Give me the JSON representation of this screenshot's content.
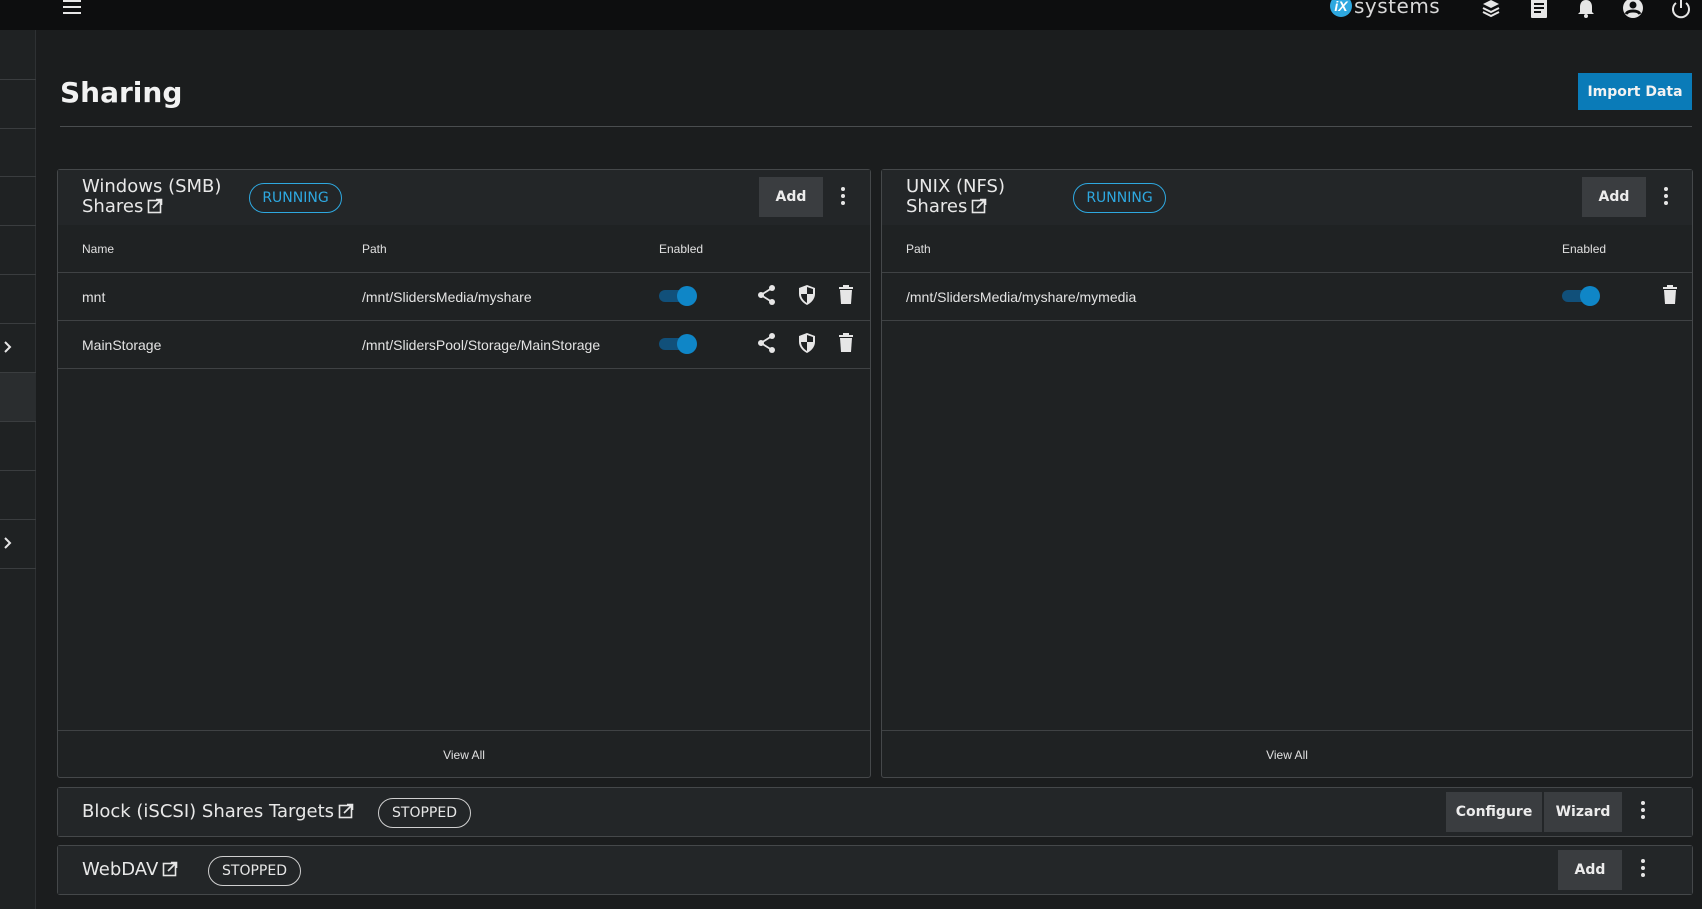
{
  "topbar": {
    "logo_letter": "iX",
    "logo_text": "systems",
    "icons": [
      "menu-icon",
      "truecommand-icon",
      "tasks-icon",
      "bell-icon",
      "account-icon",
      "power-icon"
    ]
  },
  "header": {
    "title": "Sharing",
    "import_label": "Import Data"
  },
  "smb": {
    "title_line1": "Windows (SMB)",
    "title_line2": "Shares",
    "status": "RUNNING",
    "add_label": "Add",
    "columns": [
      "Name",
      "Path",
      "Enabled"
    ],
    "rows": [
      {
        "name": "mnt",
        "path": "/mnt/SlidersMedia/myshare",
        "enabled": true
      },
      {
        "name": "MainStorage",
        "path": "/mnt/SlidersPool/Storage/MainStorage",
        "enabled": true
      }
    ],
    "view_all": "View All"
  },
  "nfs": {
    "title_line1": "UNIX (NFS)",
    "title_line2": "Shares",
    "status": "RUNNING",
    "add_label": "Add",
    "columns": [
      "Path",
      "Enabled"
    ],
    "rows": [
      {
        "path": "/mnt/SlidersMedia/myshare/mymedia",
        "enabled": true
      }
    ],
    "view_all": "View All"
  },
  "iscsi": {
    "title": "Block (iSCSI) Shares Targets",
    "status": "STOPPED",
    "configure_label": "Configure",
    "wizard_label": "Wizard"
  },
  "webdav": {
    "title": "WebDAV",
    "status": "STOPPED",
    "add_label": "Add"
  },
  "colors": {
    "accent": "#0a7bb8",
    "running": "#2ea8e0",
    "toggle_on": "#0f86c7"
  }
}
